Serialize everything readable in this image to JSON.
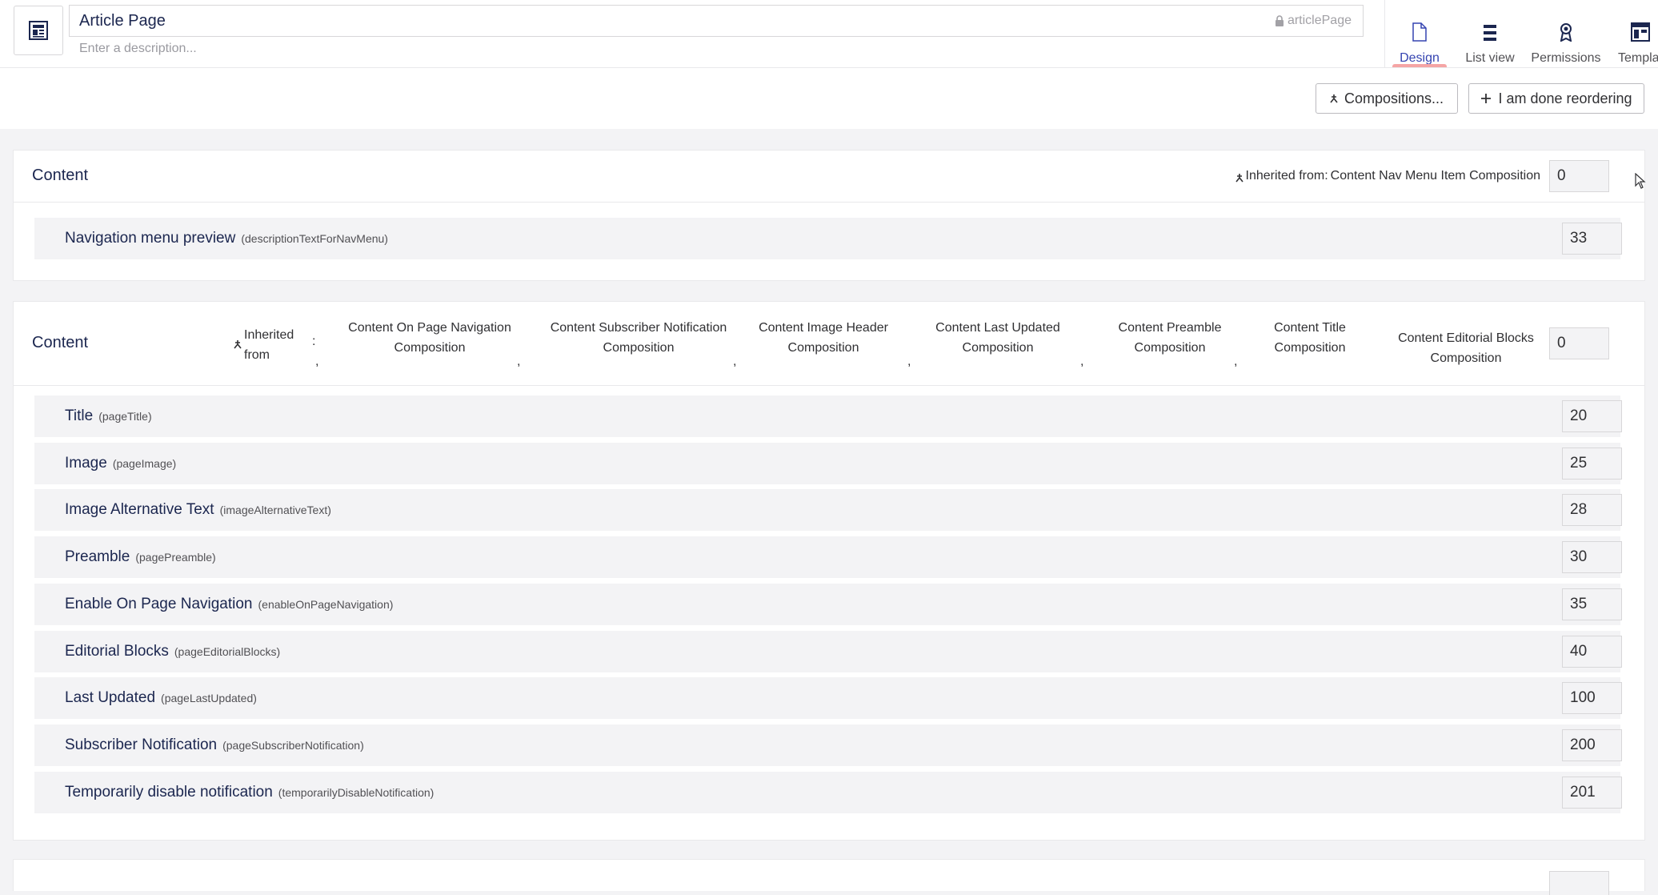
{
  "header": {
    "name": "Article Page",
    "alias": "articlePage",
    "description_placeholder": "Enter a description...",
    "nav": [
      {
        "label": "Design",
        "icon": "document-icon",
        "active": true
      },
      {
        "label": "List view",
        "icon": "list-icon",
        "active": false
      },
      {
        "label": "Permissions",
        "icon": "permissions-icon",
        "active": false
      },
      {
        "label": "Templat",
        "icon": "template-icon",
        "active": false
      }
    ]
  },
  "toolbar": {
    "compositions_label": "Compositions...",
    "done_reordering_label": "I am done reordering"
  },
  "groups": [
    {
      "title": "Content",
      "inherited_label": "Inherited from:",
      "inherited_from": "Content Nav Menu Item Composition",
      "sort_order": "0",
      "properties": [
        {
          "name": "Navigation menu preview",
          "alias": "(descriptionTextForNavMenu)",
          "sort": "33"
        }
      ]
    },
    {
      "title": "Content",
      "inherited_label_1": "Inherited",
      "inherited_label_2": "from",
      "colon": ":",
      "sort_order": "0",
      "compositions": [
        {
          "line1": "Content On Page Navigation",
          "line2": "Composition"
        },
        {
          "line1": "Content Subscriber Notification",
          "line2": "Composition"
        },
        {
          "line1": "Content Image Header",
          "line2": "Composition"
        },
        {
          "line1": "Content Last Updated",
          "line2": "Composition"
        },
        {
          "line1": "Content Preamble",
          "line2": "Composition"
        },
        {
          "line1": "Content Title",
          "line2": "Composition"
        },
        {
          "line1": "Content Editorial Blocks",
          "line2": "Composition"
        }
      ],
      "comma": ",",
      "properties": [
        {
          "name": "Title",
          "alias": "(pageTitle)",
          "sort": "20"
        },
        {
          "name": "Image",
          "alias": "(pageImage)",
          "sort": "25"
        },
        {
          "name": "Image Alternative Text",
          "alias": "(imageAlternativeText)",
          "sort": "28"
        },
        {
          "name": "Preamble",
          "alias": "(pagePreamble)",
          "sort": "30"
        },
        {
          "name": "Enable On Page Navigation",
          "alias": "(enableOnPageNavigation)",
          "sort": "35"
        },
        {
          "name": "Editorial Blocks",
          "alias": "(pageEditorialBlocks)",
          "sort": "40"
        },
        {
          "name": "Last Updated",
          "alias": "(pageLastUpdated)",
          "sort": "100"
        },
        {
          "name": "Subscriber Notification",
          "alias": "(pageSubscriberNotification)",
          "sort": "200"
        },
        {
          "name": "Temporarily disable notification",
          "alias": "(temporarilyDisableNotification)",
          "sort": "201"
        }
      ]
    }
  ]
}
